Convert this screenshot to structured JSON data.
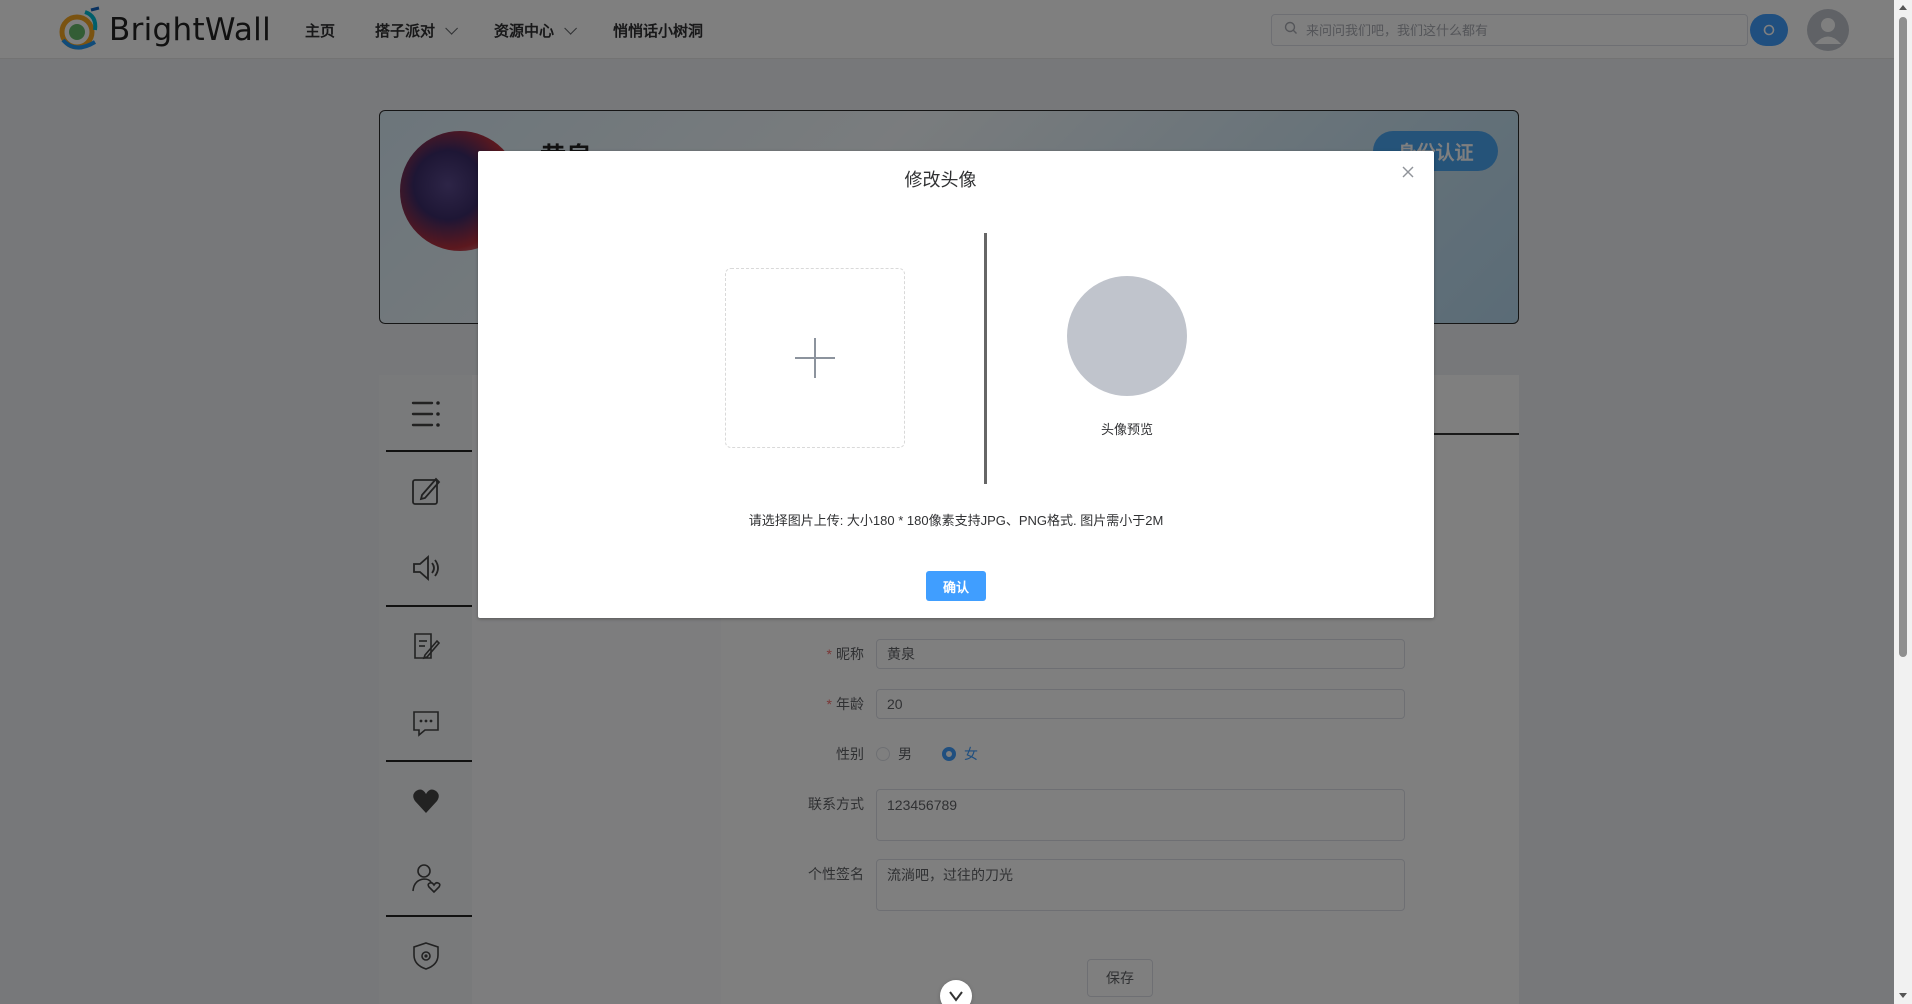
{
  "header": {
    "logo_text": "BrightWall",
    "nav": [
      {
        "label": "主页",
        "has_dropdown": false
      },
      {
        "label": "搭子派对",
        "has_dropdown": true
      },
      {
        "label": "资源中心",
        "has_dropdown": true
      },
      {
        "label": "悄悄话小树洞",
        "has_dropdown": false
      }
    ],
    "search_placeholder": "来问问我们吧，我们这什么都有",
    "accent_color": "#409eff"
  },
  "profile": {
    "name": "黄泉",
    "auth_button": "身份认证"
  },
  "sidebar": {
    "icons": [
      "menu-icon",
      "edit-icon",
      "speaker-icon",
      "document-edit-icon",
      "message-icon",
      "heart-icon",
      "user-heart-icon",
      "shield-icon"
    ]
  },
  "form": {
    "nickname_label": "昵称",
    "nickname_value": "黄泉",
    "age_label": "年龄",
    "age_value": "20",
    "gender_label": "性别",
    "gender_options": [
      "男",
      "女"
    ],
    "gender_selected": "女",
    "contact_label": "联系方式",
    "contact_value": "123456789",
    "signature_label": "个性签名",
    "signature_value": "流淌吧，过往的刀光",
    "save_label": "保存"
  },
  "modal": {
    "title": "修改头像",
    "preview_label": "头像预览",
    "hint": "请选择图片上传: 大小180 * 180像素支持JPG、PNG格式. 图片需小于2M",
    "confirm_label": "确认"
  }
}
